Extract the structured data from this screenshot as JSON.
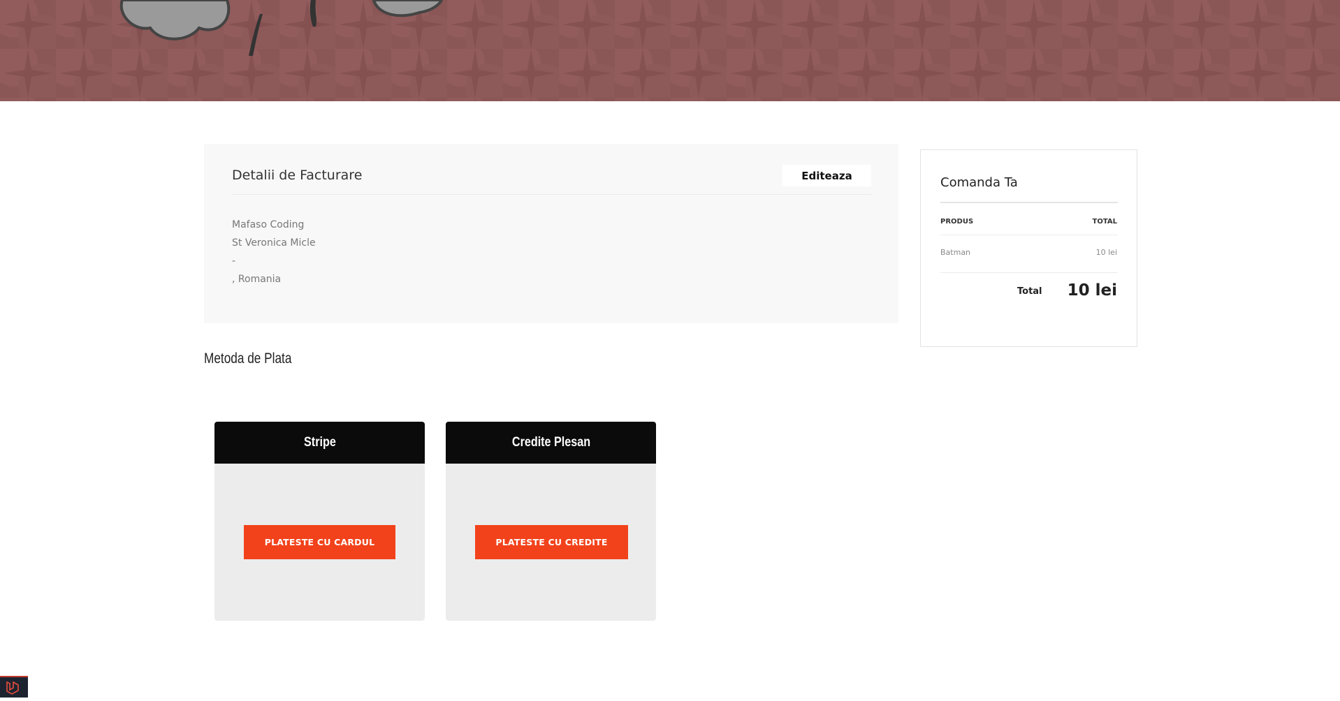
{
  "billing": {
    "title": "Detalii de Facturare",
    "edit_label": "Editeaza",
    "address_lines": [
      "Mafaso Coding",
      "St Veronica Micle",
      "-",
      ", Romania"
    ]
  },
  "payment": {
    "title": "Metoda de Plata",
    "methods": [
      {
        "name": "Stripe",
        "button": "PLATESTE CU CARDUL"
      },
      {
        "name": "Credite Plesan",
        "button": "PLATESTE CU CREDITE"
      }
    ]
  },
  "order": {
    "title": "Comanda Ta",
    "col_product": "PRODUS",
    "col_total": "TOTAL",
    "items": [
      {
        "name": "Batman",
        "price": "10 lei"
      }
    ],
    "total_label": "Total",
    "total_value": "10 lei"
  },
  "colors": {
    "hero": "#8a5656",
    "accent": "#f2421b",
    "card_head": "#0b0b0b"
  },
  "icons": {
    "corner_badge": "laravel-icon"
  }
}
